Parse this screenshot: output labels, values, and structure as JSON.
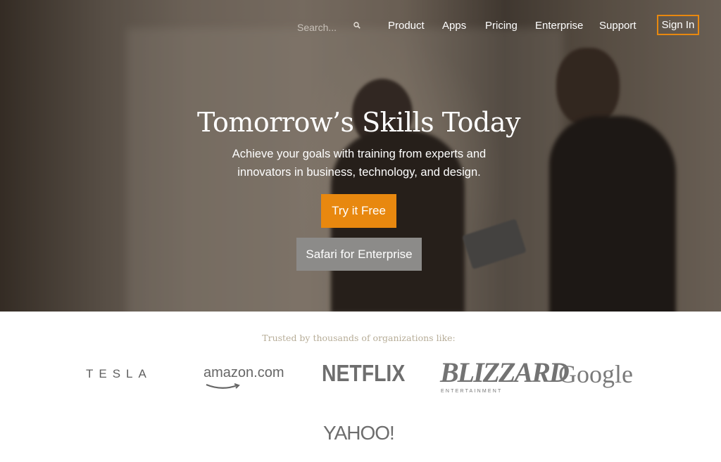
{
  "nav": {
    "search_placeholder": "Search...",
    "links": [
      {
        "label": "Product"
      },
      {
        "label": "Apps"
      },
      {
        "label": "Pricing"
      },
      {
        "label": "Enterprise"
      },
      {
        "label": "Support"
      }
    ],
    "sign_in_label": "Sign In"
  },
  "hero": {
    "headline": "Tomorrow’s Skills Today",
    "subheadline": "Achieve your goals with training from experts and innovators in business, technology, and design.",
    "primary_button": "Try it Free",
    "secondary_button": "Safari for Enterprise"
  },
  "trusted": {
    "heading": "Trusted by thousands of organizations like:",
    "logos": [
      {
        "name": "TESLA",
        "icon": "tesla-logo"
      },
      {
        "name": "amazon.com",
        "icon": "amazon-logo"
      },
      {
        "name": "NETFLIX",
        "icon": "netflix-logo"
      },
      {
        "name": "BLIZZARD",
        "sub": "ENTERTAINMENT",
        "icon": "blizzard-logo"
      },
      {
        "name": "Google",
        "icon": "google-logo"
      },
      {
        "name": "YAHOO!",
        "icon": "yahoo-logo"
      }
    ]
  },
  "colors": {
    "accent": "#e8880f",
    "secondary_button": "#8c8b89",
    "trusted_text": "#b7ad98",
    "logo_gray": "#6b6b6b"
  }
}
